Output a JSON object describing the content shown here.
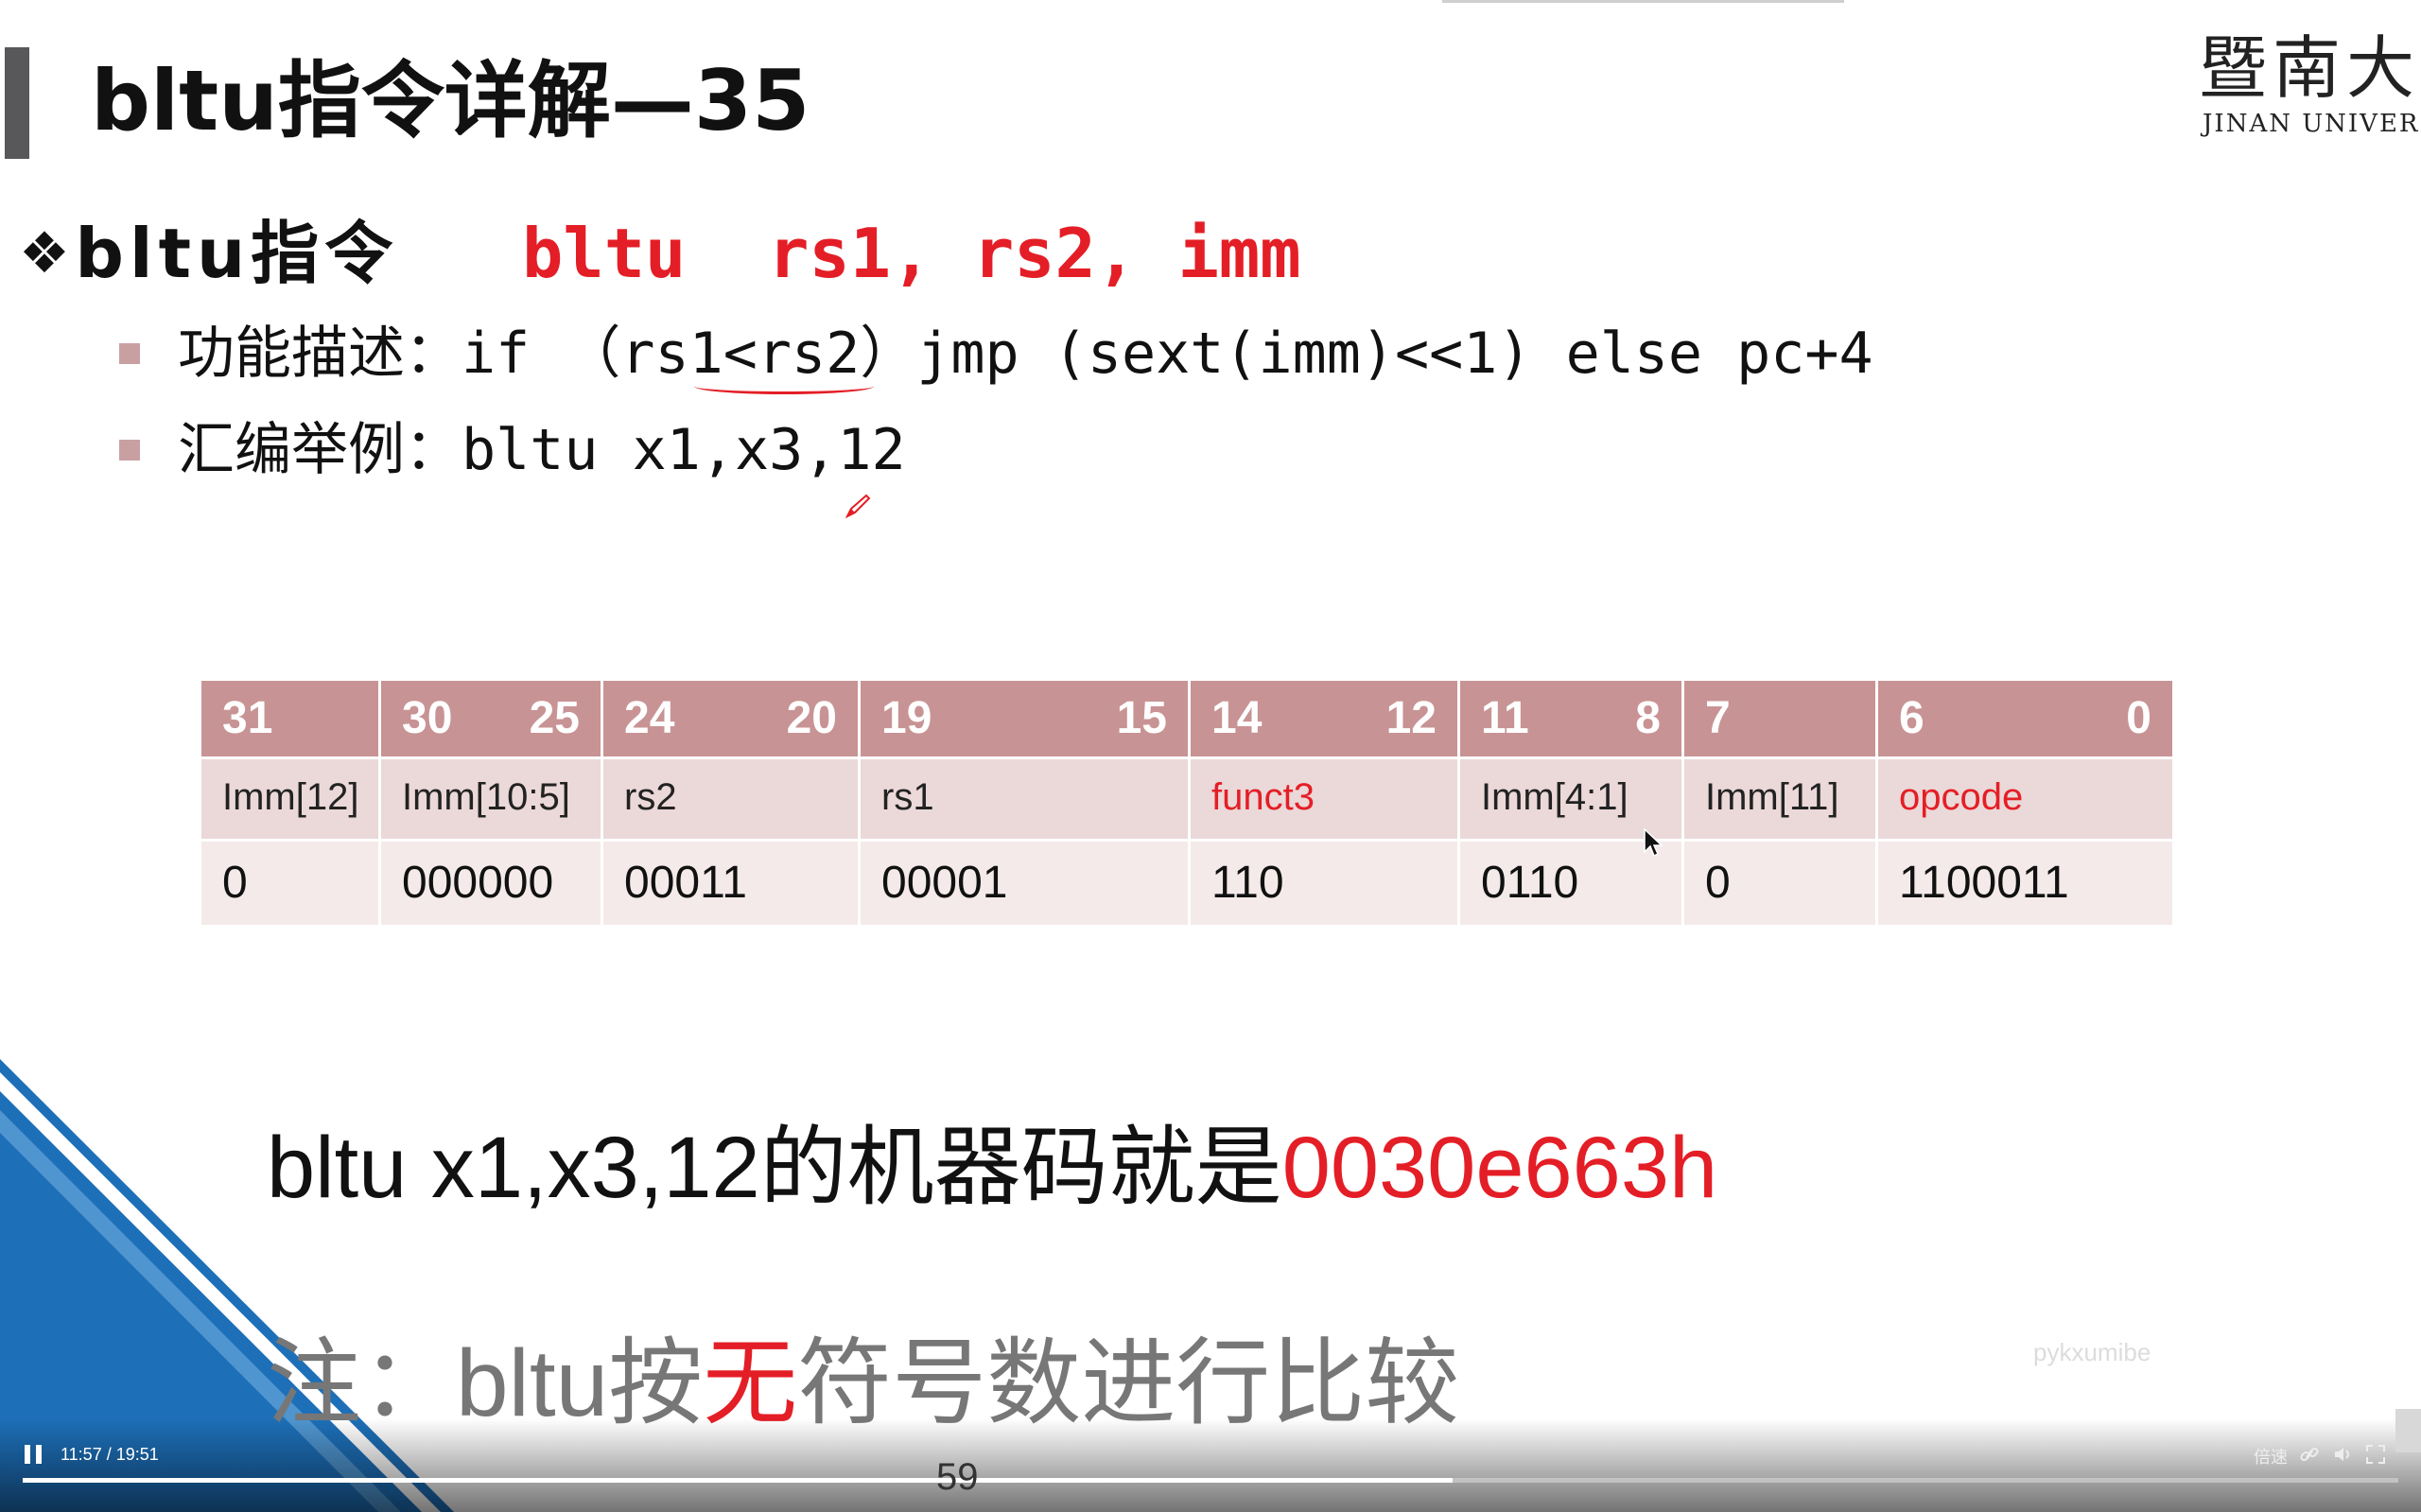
{
  "slide": {
    "title": "bltu指令详解—35",
    "logo_cn": "暨南大学",
    "logo_en": "JINAN UNIVERSITY",
    "instruction_label": "bltu指令",
    "instruction_syntax": "bltu  rs1, rs2, imm",
    "bullets": [
      "功能描述：if （rs1<rs2）jmp (sext(imm)<<1) else pc+4",
      "汇编举例：bltu x1,x3,12"
    ]
  },
  "table": {
    "columns": [
      {
        "bit_hi": "31",
        "bit_lo": "",
        "field": "Imm[12]",
        "value": "0",
        "field_red": false
      },
      {
        "bit_hi": "30",
        "bit_lo": "25",
        "field": "Imm[10:5]",
        "value": "000000",
        "field_red": false
      },
      {
        "bit_hi": "24",
        "bit_lo": "20",
        "field": "rs2",
        "value": "00011",
        "field_red": false
      },
      {
        "bit_hi": "19",
        "bit_lo": "15",
        "field": "rs1",
        "value": "00001",
        "field_red": false
      },
      {
        "bit_hi": "14",
        "bit_lo": "12",
        "field": "funct3",
        "value": "110",
        "field_red": true
      },
      {
        "bit_hi": "11",
        "bit_lo": "8",
        "field": "Imm[4:1]",
        "value": "0110",
        "field_red": false
      },
      {
        "bit_hi": "7",
        "bit_lo": "",
        "field": "Imm[11]",
        "value": "0",
        "field_red": false
      },
      {
        "bit_hi": "6",
        "bit_lo": "0",
        "field": "opcode",
        "value": "1100011",
        "field_red": true
      }
    ]
  },
  "statement": {
    "prefix": "bltu x1,x3,12的机器码就是",
    "value": "0030e663h"
  },
  "note": {
    "prefix": "注：bltu按",
    "highlight": "无",
    "suffix": "符号数进行比较"
  },
  "watermark": "pykxumibe",
  "page_number": "59",
  "player": {
    "time": "11:57 / 19:51",
    "progress": 0.602,
    "speed_label": "倍速",
    "icons": [
      "pause-icon",
      "link-icon",
      "volume-icon",
      "fullscreen-icon"
    ]
  },
  "colors": {
    "accent_red": "#e41e26",
    "table_header": "#c89394",
    "table_field_row": "#ebd8d8",
    "table_value_row": "#f4eaea",
    "corner_blue": "#1d6fb8"
  }
}
